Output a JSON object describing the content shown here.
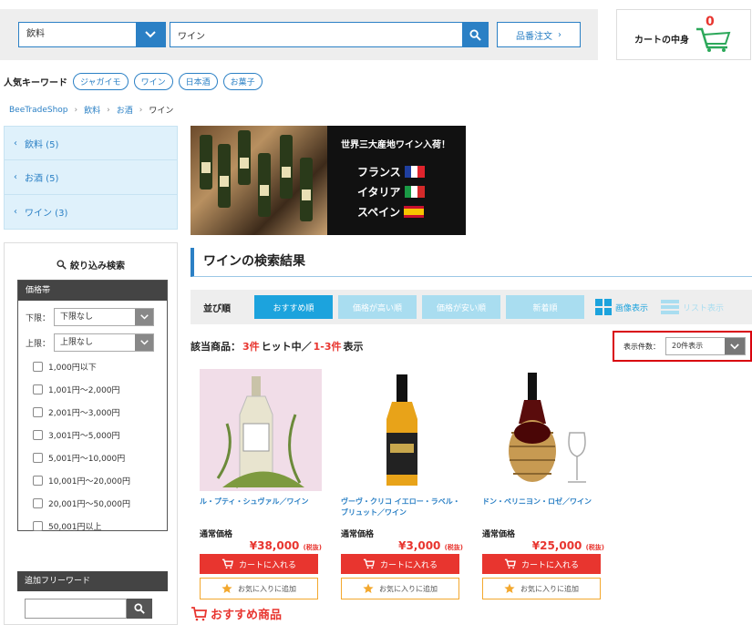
{
  "header": {
    "category_select": "飲料",
    "search_value": "ワイン",
    "order_button": "品番注文",
    "cart_label": "カートの中身",
    "cart_count": "0"
  },
  "keywords": {
    "label": "人気キーワード",
    "items": [
      "ジャガイモ",
      "ワイン",
      "日本酒",
      "お菓子"
    ]
  },
  "breadcrumb": [
    "BeeTradeShop",
    "飲料",
    "お酒",
    "ワイン"
  ],
  "categories": [
    "飲料 (5)",
    "お酒 (5)",
    "ワイン (3)"
  ],
  "filter": {
    "title": "絞り込み検索",
    "price_head": "価格帯",
    "lower_label": "下限：",
    "lower_value": "下限なし",
    "upper_label": "上限：",
    "upper_value": "上限なし",
    "ranges": [
      "1,000円以下",
      "1,001円～2,000円",
      "2,001円～3,000円",
      "3,001円～5,000円",
      "5,001円～10,000円",
      "10,001円～20,000円",
      "20,001円～50,000円",
      "50,001円以上"
    ],
    "freeword_head": "追加フリーワード",
    "freeword_value": ""
  },
  "banner": {
    "headline": "世界三大産地ワイン入荷！",
    "countries": [
      "フランス",
      "イタリア",
      "スペイン"
    ]
  },
  "results": {
    "title": "ワインの検索結果",
    "sort_label": "並び順",
    "sort_options": [
      "おすすめ順",
      "価格が高い順",
      "価格が安い順",
      "新着順"
    ],
    "view_image": "画像表示",
    "view_list": "リスト表示",
    "hits_prefix": "該当商品：",
    "hits_count": "3件",
    "hits_mid": "ヒット中／",
    "hits_range": "1-3件",
    "hits_suffix": "表示",
    "perpage_label": "表示件数：",
    "perpage_value": "20件表示"
  },
  "products": [
    {
      "name": "ル・プティ・シュヴァル／ワイン",
      "price_label": "通常価格",
      "price": "¥38,000",
      "tax": "(税抜)",
      "cart": "カートに入れる",
      "fav": "お気に入りに追加"
    },
    {
      "name": "ヴーヴ・クリコ イエロー・ラベル・ブリュット／ワイン",
      "price_label": "通常価格",
      "price": "¥3,000",
      "tax": "(税抜)",
      "cart": "カートに入れる",
      "fav": "お気に入りに追加"
    },
    {
      "name": "ドン・ペリニヨン・ロゼ／ワイン",
      "price_label": "通常価格",
      "price": "¥25,000",
      "tax": "(税抜)",
      "cart": "カートに入れる",
      "fav": "お気に入りに追加"
    }
  ],
  "recommend_title": "おすすめ商品",
  "colors": {
    "accent": "#2b80c5",
    "sky": "#1ca3dd",
    "red": "#e8352f",
    "highlight": "#d9000d",
    "star": "#f3a82e"
  }
}
